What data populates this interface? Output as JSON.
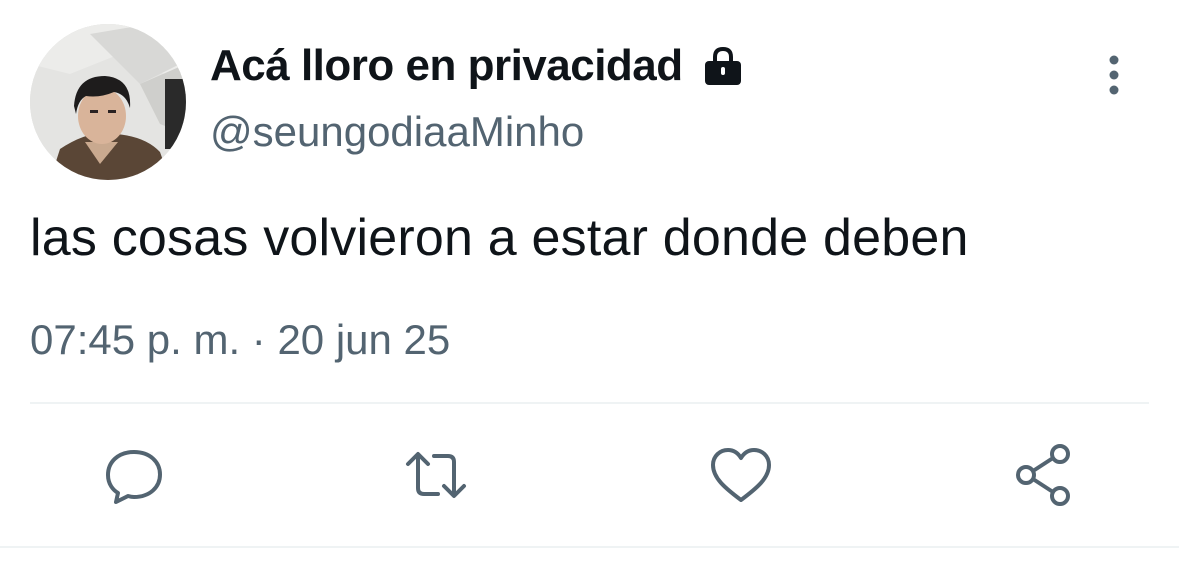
{
  "tweet": {
    "display_name": "Acá lloro en privacidad",
    "handle": "@seungodiaaMinho",
    "text": "las cosas volvieron a estar donde deben",
    "timestamp": "07:45 p. m. · 20 jun 25",
    "protected": true
  },
  "icons": {
    "lock": "lock-icon",
    "more": "more-vertical-icon",
    "reply": "reply-icon",
    "retweet": "retweet-icon",
    "like": "heart-icon",
    "share": "share-icon"
  },
  "colors": {
    "text_primary": "#0f1419",
    "text_secondary": "#536471",
    "icon": "#536471",
    "divider": "#eff3f4"
  }
}
